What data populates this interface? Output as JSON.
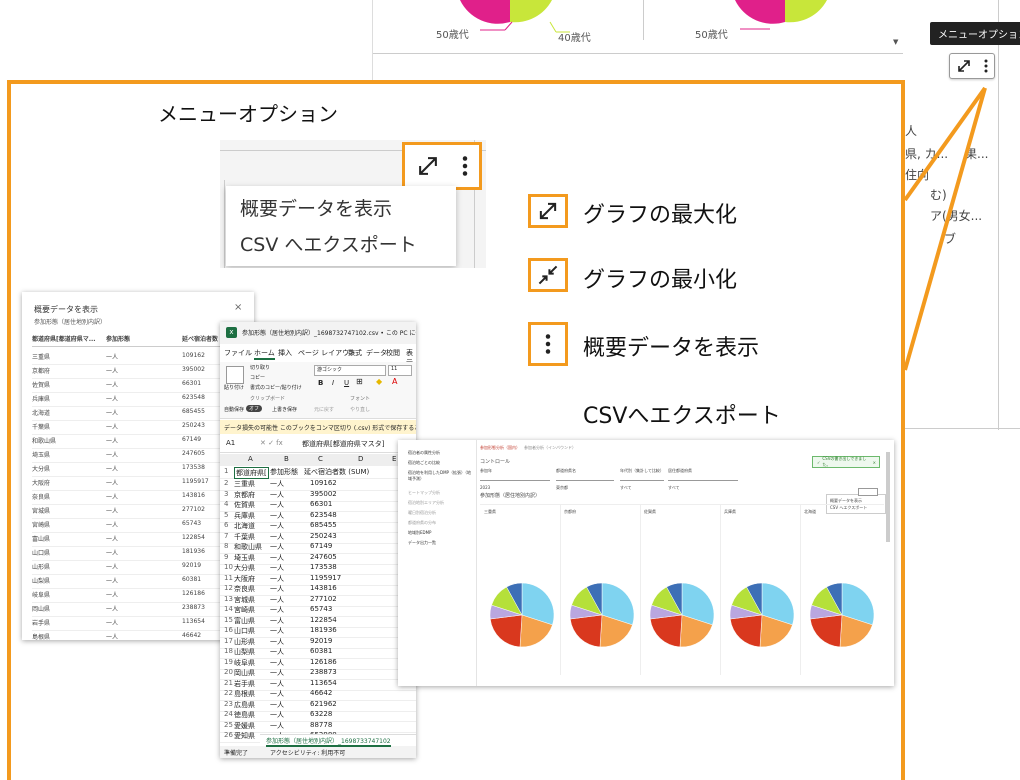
{
  "background": {
    "label_50s_left": "50歳代",
    "label_40s": "40歳代",
    "label_50s_right": "50歳代",
    "partial_texts": [
      "人",
      "県, カ...",
      "果...",
      "住向",
      "む)",
      "ア(男女...",
      "ブ"
    ],
    "tooltip": "メニューオプション"
  },
  "callout": {
    "title": "メニューオプション",
    "menu_items": [
      "概要データを表示",
      "CSV へエクスポート"
    ]
  },
  "legend": {
    "maximize": "グラフの最大化",
    "minimize": "グラフの最小化",
    "show_summary": "概要データを表示",
    "csv_export": "CSVへエクスポート"
  },
  "summary_dialog": {
    "title": "概要データを表示",
    "subtitle": "参加形態（居住地別内訳）",
    "close": "×",
    "headers": [
      "都道府県[都道府県マ...",
      "参加形態",
      "延べ宿泊者数 (SUM)"
    ],
    "rows": [
      [
        "三重県",
        "一人",
        "109162"
      ],
      [
        "京都府",
        "一人",
        "395002"
      ],
      [
        "佐賀県",
        "一人",
        "66301"
      ],
      [
        "兵庫県",
        "一人",
        "623548"
      ],
      [
        "北海道",
        "一人",
        "685455"
      ],
      [
        "千葉県",
        "一人",
        "250243"
      ],
      [
        "和歌山県",
        "一人",
        "67149"
      ],
      [
        "埼玉県",
        "一人",
        "247605"
      ],
      [
        "大分県",
        "一人",
        "173538"
      ],
      [
        "大阪府",
        "一人",
        "1195917"
      ],
      [
        "奈良県",
        "一人",
        "143816"
      ],
      [
        "宮城県",
        "一人",
        "277102"
      ],
      [
        "宮崎県",
        "一人",
        "65743"
      ],
      [
        "富山県",
        "一人",
        "122854"
      ],
      [
        "山口県",
        "一人",
        "181936"
      ],
      [
        "山形県",
        "一人",
        "92019"
      ],
      [
        "山梨県",
        "一人",
        "60381"
      ],
      [
        "岐阜県",
        "一人",
        "126186"
      ],
      [
        "岡山県",
        "一人",
        "238873"
      ],
      [
        "岩手県",
        "一人",
        "113654"
      ],
      [
        "島根県",
        "一人",
        "46642"
      ]
    ]
  },
  "excel": {
    "title": "参加形態（居住地別内訳）_1698732747102.csv • この PC に保存済み",
    "tabs": [
      "ファイル",
      "ホーム",
      "挿入",
      "ページ レイアウト",
      "数式",
      "データ",
      "校閲",
      "表示"
    ],
    "ribbon": {
      "cut": "切り取り",
      "copy": "コピー",
      "format_painter": "書式のコピー/貼り付け",
      "paste": "貼り付け",
      "clipboard": "クリップボード",
      "font_name": "游ゴシック",
      "font_size": "11",
      "font_group": "フォント",
      "autosave": "自動保存",
      "autosave_state": "オフ",
      "overwrite": "上書き保存",
      "undo": "元に戻す",
      "redo": "やり直し"
    },
    "warning": "データ損失の可能性 このブックをコンマ区切り (.csv) 形式で保存すると、一部の",
    "cell_ref": "A1",
    "formula": "都道府県[都道府県マスタ]",
    "col_headers": [
      "A",
      "B",
      "C",
      "D",
      "E"
    ],
    "header_row": [
      "都道府県[",
      "参加形態",
      "延べ宿泊者数 (SUM)"
    ],
    "rows": [
      [
        "三重県",
        "一人",
        "109162"
      ],
      [
        "京都府",
        "一人",
        "395002"
      ],
      [
        "佐賀県",
        "一人",
        "66301"
      ],
      [
        "兵庫県",
        "一人",
        "623548"
      ],
      [
        "北海道",
        "一人",
        "685455"
      ],
      [
        "千葉県",
        "一人",
        "250243"
      ],
      [
        "和歌山県",
        "一人",
        "67149"
      ],
      [
        "埼玉県",
        "一人",
        "247605"
      ],
      [
        "大分県",
        "一人",
        "173538"
      ],
      [
        "大阪府",
        "一人",
        "1195917"
      ],
      [
        "奈良県",
        "一人",
        "143816"
      ],
      [
        "宮城県",
        "一人",
        "277102"
      ],
      [
        "宮崎県",
        "一人",
        "65743"
      ],
      [
        "富山県",
        "一人",
        "122854"
      ],
      [
        "山口県",
        "一人",
        "181936"
      ],
      [
        "山形県",
        "一人",
        "92019"
      ],
      [
        "山梨県",
        "一人",
        "60381"
      ],
      [
        "岐阜県",
        "一人",
        "126186"
      ],
      [
        "岡山県",
        "一人",
        "238873"
      ],
      [
        "岩手県",
        "一人",
        "113654"
      ],
      [
        "島根県",
        "一人",
        "46642"
      ],
      [
        "広島県",
        "一人",
        "621962"
      ],
      [
        "徳島県",
        "一人",
        "63228"
      ],
      [
        "愛媛県",
        "一人",
        "88778"
      ],
      [
        "愛知県",
        "一人",
        "652980"
      ]
    ],
    "sheet_tab": "参加形態（居住地別内訳）_1698733747102",
    "status_ready": "準備完了",
    "status_access": "アクセシビリティ: 利用不可"
  },
  "dashboard": {
    "nav_items": [
      "宿泊者の属性分析",
      "宿泊地ごとの比較",
      "宿泊地を利用したDMP（拡張）（地域予測）",
      "ヒートマップ分析",
      "宿泊地別エリア分析",
      "曜日別宿泊分析",
      "都道府県の分布",
      "地域別EDMP",
      "データ出力一覧"
    ],
    "tabs": [
      "参加形態分析（国内）",
      "参加者分析（インバウンド）"
    ],
    "control": "コントロール",
    "filters": [
      "参加年",
      "都道府県名",
      "年代別（集計して比較）",
      "居住都道府県"
    ],
    "filter_values": [
      "2023",
      "東京都",
      "すべて",
      "すべて"
    ],
    "toast": "CSVの書き出しできました。",
    "chart_title": "参加形態（居住地別内訳）",
    "panel_titles": [
      "三重県",
      "京都府",
      "佐賀県",
      "兵庫県",
      "北海道"
    ],
    "menu_items": [
      "概要データを表示",
      "CSV へエクスポート"
    ]
  },
  "colors": {
    "accent_orange": "#f39a1e",
    "pie_blue": "#7fd3f0",
    "pie_orange": "#f4a14b",
    "pie_red": "#d9381e",
    "pie_lavender": "#b9a7e0",
    "pie_lime": "#b5e03a",
    "pie_navy": "#3d6fb6",
    "bg_magenta": "#e0208a",
    "bg_lime": "#c8e63a"
  }
}
